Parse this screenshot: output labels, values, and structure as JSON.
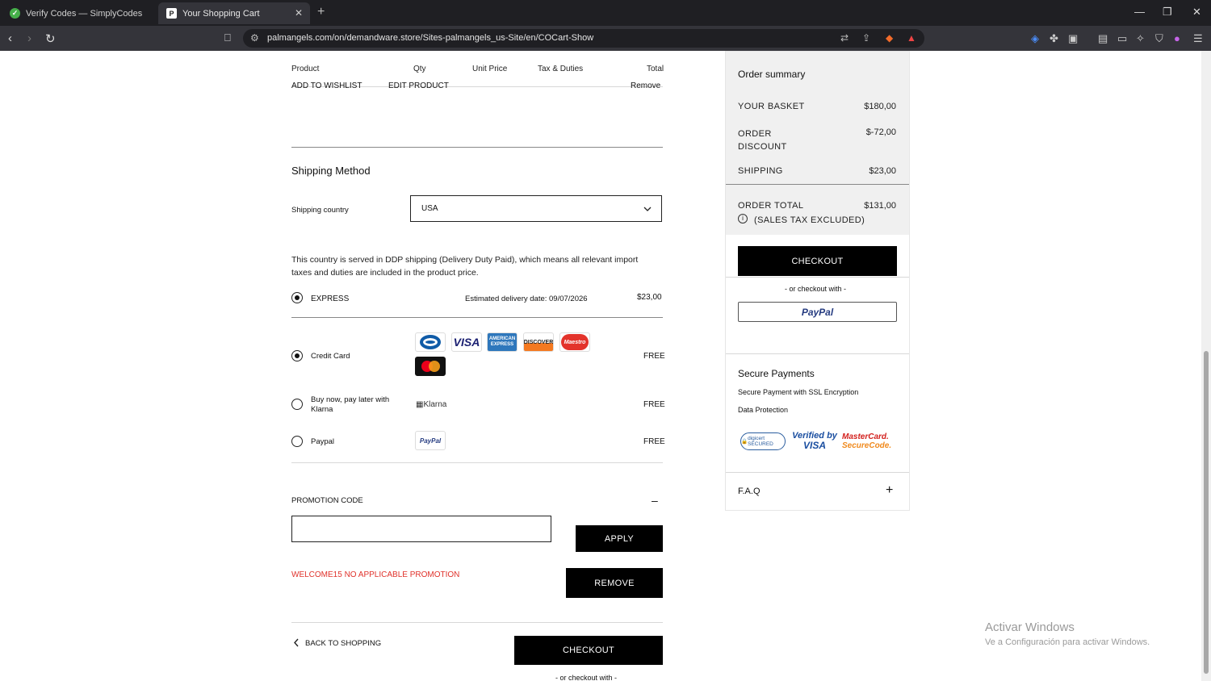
{
  "browser": {
    "tabs": [
      {
        "title": "Verify Codes — SimplyCodes"
      },
      {
        "title": "Your Shopping Cart"
      }
    ],
    "url": "palmangels.com/on/demandware.store/Sites-palmangels_us-Site/en/COCart-Show"
  },
  "cart": {
    "headers": {
      "product": "Product",
      "qty": "Qty",
      "unit_price": "Unit Price",
      "tax": "Tax & Duties",
      "total": "Total"
    },
    "item_actions": {
      "wishlist": "ADD TO WISHLIST",
      "edit": "EDIT PRODUCT",
      "remove": "Remove"
    }
  },
  "shipping": {
    "title": "Shipping Method",
    "country_label": "Shipping country",
    "country_value": "USA",
    "ddp_note": "This country is served in DDP shipping (Delivery Duty Paid), which means all relevant import taxes and duties are included in the product price.",
    "method_label": "EXPRESS",
    "delivery_estimate": "Estimated delivery date: 09/07/2026",
    "method_price": "$23,00"
  },
  "payment": {
    "options": [
      {
        "label": "Credit Card",
        "price": "FREE"
      },
      {
        "label": "Buy now, pay later with Klarna",
        "price": "FREE",
        "logo_alt": "Klarna"
      },
      {
        "label": "Paypal",
        "price": "FREE"
      }
    ],
    "card_logos": [
      "Diners",
      "VISA",
      "AMERICAN EXPRESS",
      "DISCOVER",
      "Maestro",
      "mastercard"
    ]
  },
  "promo": {
    "title": "PROMOTION CODE",
    "toggle": "–",
    "input_value": "",
    "apply": "APPLY",
    "message": "WELCOME15 NO APPLICABLE PROMOTION",
    "remove": "REMOVE",
    "message_color": "#e0322b"
  },
  "bottom": {
    "back": "BACK TO SHOPPING",
    "checkout": "CHECKOUT",
    "or_checkout": "- or checkout with -"
  },
  "summary": {
    "title": "Order summary",
    "basket_label": "YOUR BASKET",
    "basket_value": "$180,00",
    "discount_label": "ORDER DISCOUNT",
    "discount_value": "$-72,00",
    "shipping_label": "SHIPPING",
    "shipping_value": "$23,00",
    "total_label": "ORDER TOTAL",
    "total_value": "$131,00",
    "tax_note": "(SALES TAX EXCLUDED)",
    "checkout": "CHECKOUT",
    "or_checkout": "- or checkout with -",
    "paypal": "PayPal",
    "secure_title": "Secure Payments",
    "secure_line1": "Secure Payment with SSL Encryption",
    "secure_line2": "Data Protection",
    "badges": {
      "digicert": "digicert SECURED",
      "visa_top": "Verified by",
      "visa_bottom": "VISA",
      "mc_top": "MasterCard.",
      "mc_bottom": "SecureCode."
    },
    "faq": "F.A.Q",
    "faq_toggle": "+"
  },
  "watermark": {
    "title": "Activar Windows",
    "subtitle": "Ve a Configuración para activar Windows."
  }
}
